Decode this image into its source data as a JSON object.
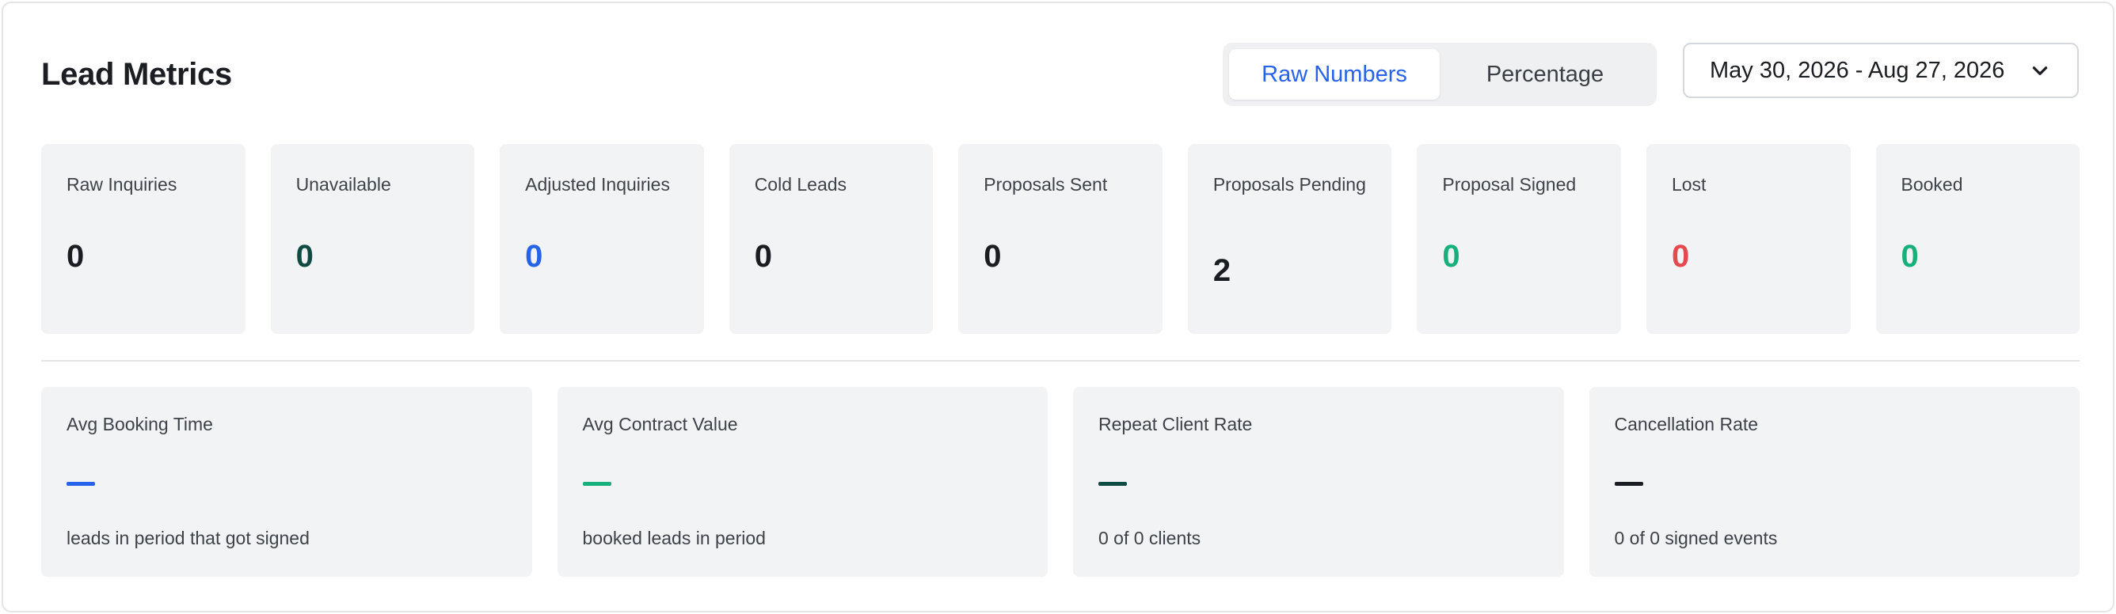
{
  "header": {
    "title": "Lead Metrics",
    "toggle": {
      "options": [
        "Raw Numbers",
        "Percentage"
      ],
      "selected": "Raw Numbers"
    },
    "date_range": "May 30, 2026 - Aug 27, 2026"
  },
  "metrics": [
    {
      "label": "Raw Inquiries",
      "value": "0",
      "color": "#1a1d21"
    },
    {
      "label": "Unavailable",
      "value": "0",
      "color": "#0f4b43"
    },
    {
      "label": "Adjusted Inquiries",
      "value": "0",
      "color": "#2563eb"
    },
    {
      "label": "Cold Leads",
      "value": "0",
      "color": "#1a1d21"
    },
    {
      "label": "Proposals Sent",
      "value": "0",
      "color": "#1a1d21"
    },
    {
      "label": "Proposals Pending",
      "value": "2",
      "color": "#1a1d21"
    },
    {
      "label": "Proposal Signed",
      "value": "0",
      "color": "#16b07a"
    },
    {
      "label": "Lost",
      "value": "0",
      "color": "#e5484d"
    },
    {
      "label": "Booked",
      "value": "0",
      "color": "#16b07a"
    }
  ],
  "stats": [
    {
      "label": "Avg Booking Time",
      "value": "—",
      "sub": "leads in period that got signed",
      "color": "#2563eb"
    },
    {
      "label": "Avg Contract Value",
      "value": "—",
      "sub": "booked leads in period",
      "color": "#16b07a"
    },
    {
      "label": "Repeat Client Rate",
      "value": "—",
      "sub": "0 of 0 clients",
      "color": "#0f4b43"
    },
    {
      "label": "Cancellation Rate",
      "value": "—",
      "sub": "0 of 0 signed events",
      "color": "#1a1d21"
    }
  ],
  "icons": {
    "date_dropdown": "chevron-down-icon"
  }
}
